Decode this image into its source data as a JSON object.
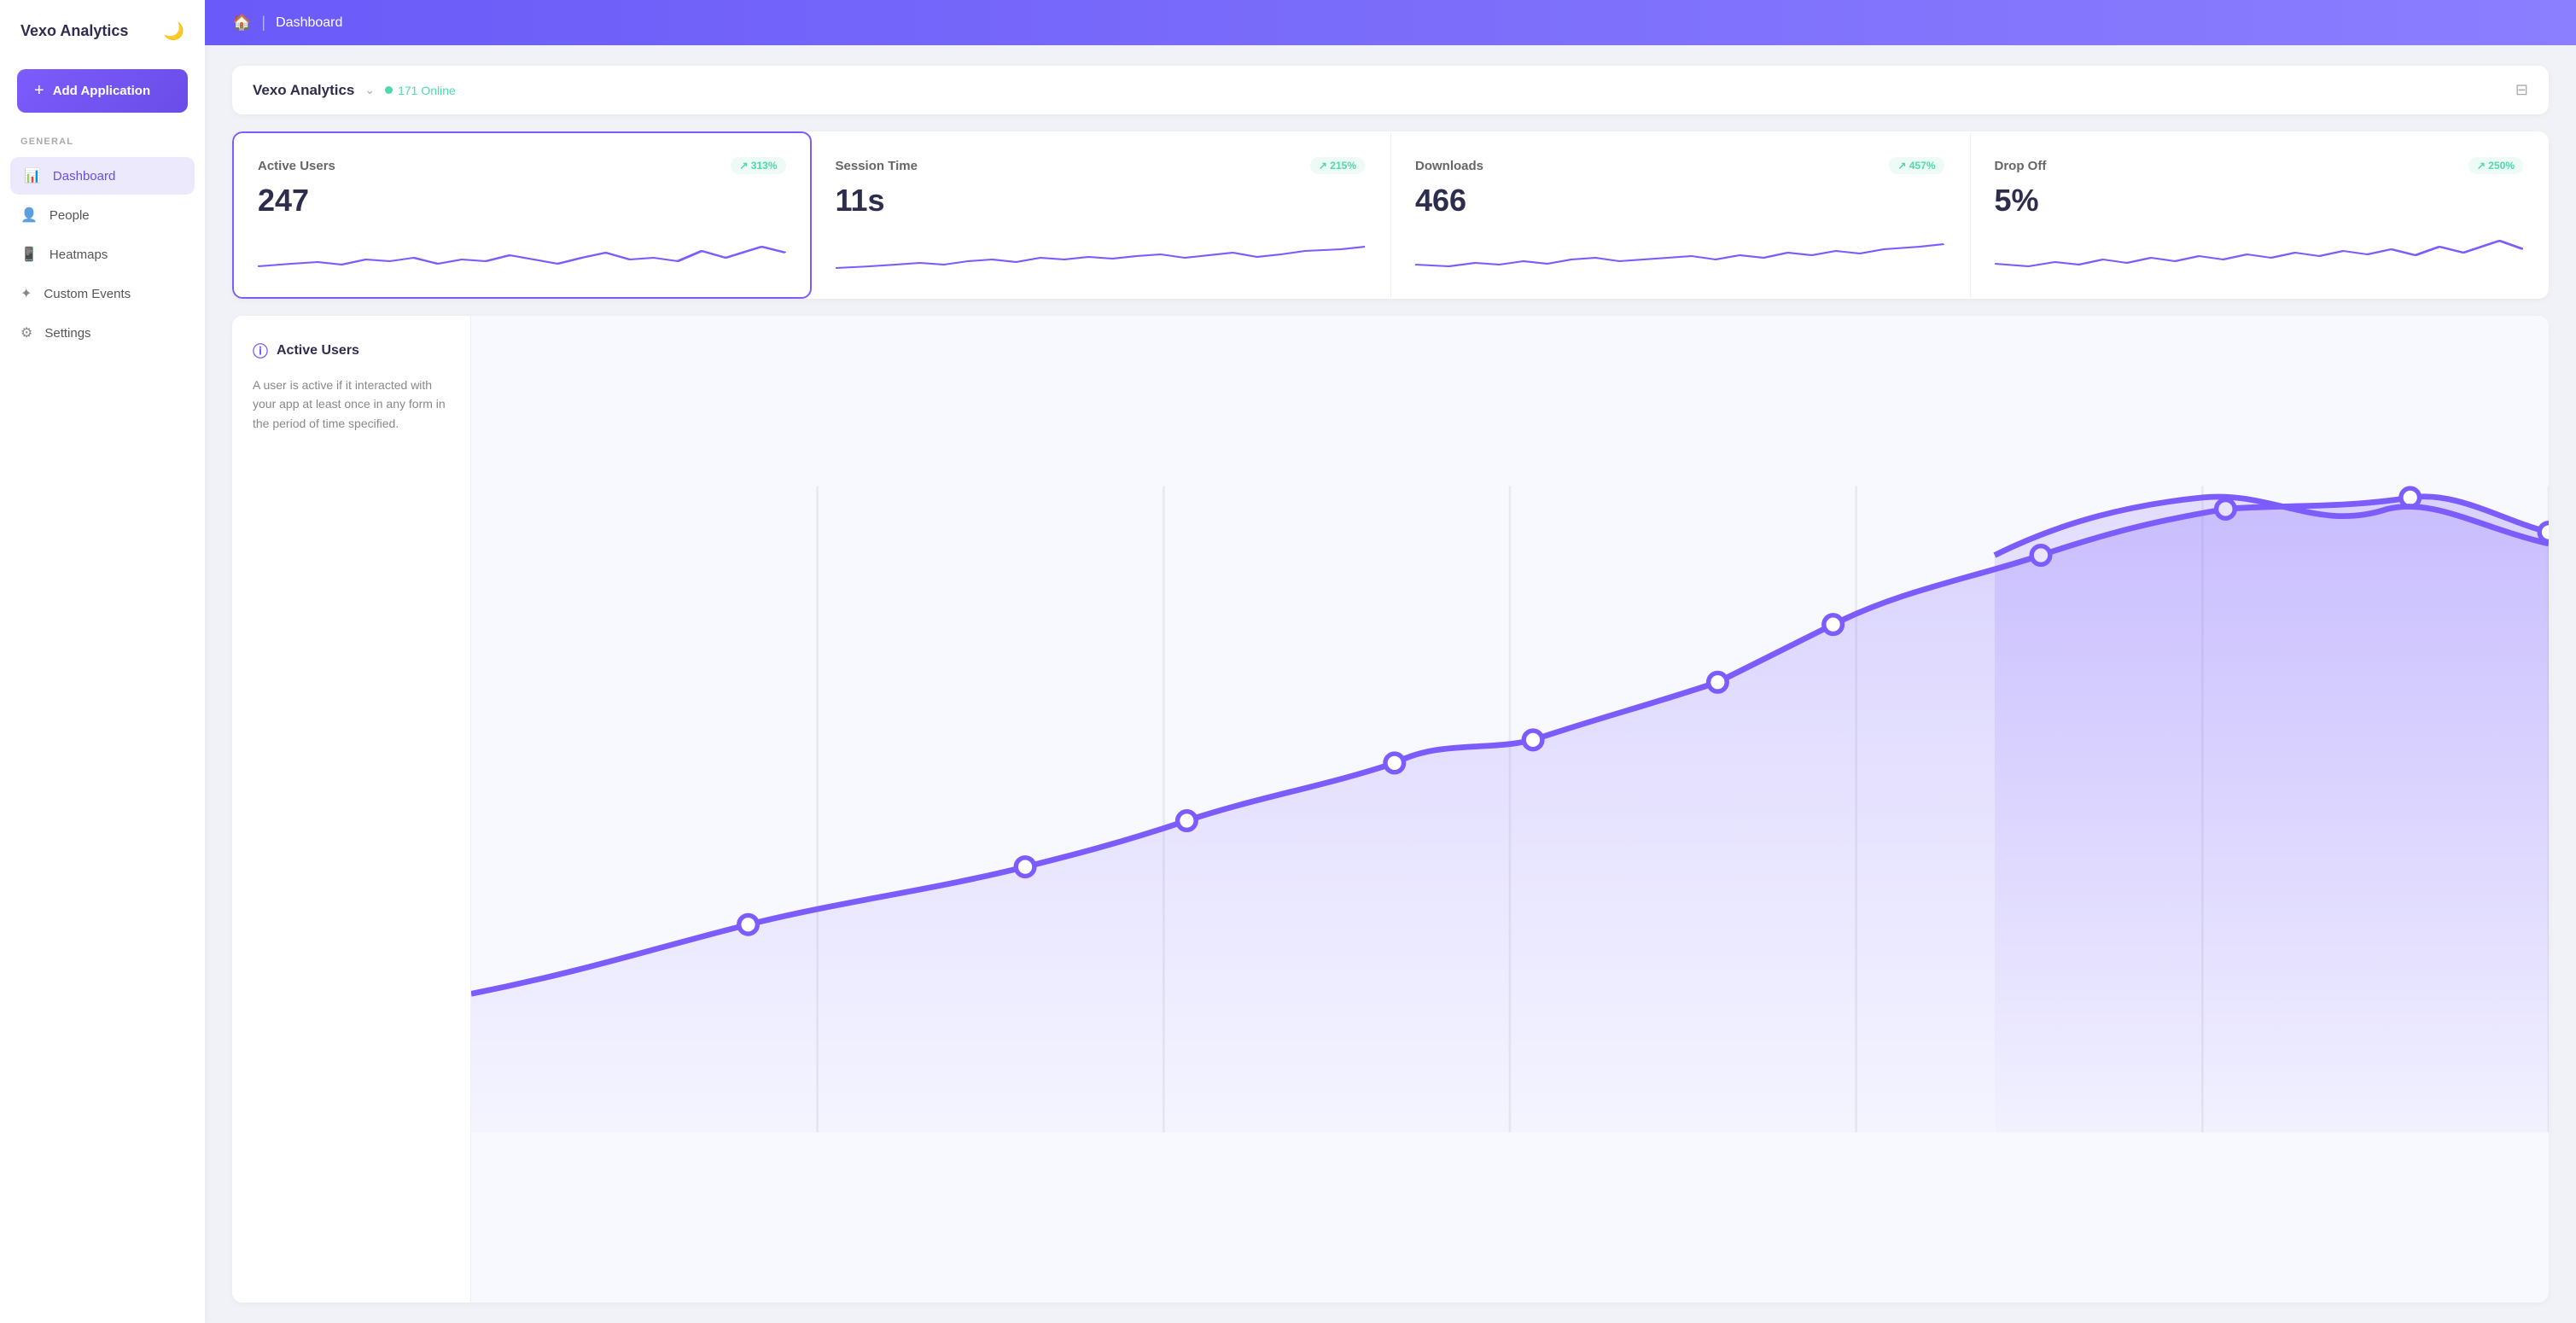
{
  "sidebar": {
    "logo": "Vexo Analytics",
    "logo_icon": "🌙",
    "add_btn_label": "Add Application",
    "section_label": "GENERAL",
    "nav_items": [
      {
        "id": "dashboard",
        "label": "Dashboard",
        "icon": "📊",
        "active": true
      },
      {
        "id": "people",
        "label": "People",
        "icon": "👤",
        "active": false
      },
      {
        "id": "heatmaps",
        "label": "Heatmaps",
        "icon": "📱",
        "active": false
      },
      {
        "id": "custom-events",
        "label": "Custom Events",
        "icon": "✦",
        "active": false
      },
      {
        "id": "settings",
        "label": "Settings",
        "icon": "⚙",
        "active": false
      }
    ]
  },
  "topbar": {
    "home_icon": "🏠",
    "title": "Dashboard"
  },
  "app_selector": {
    "app_name": "Vexo Analytics",
    "online_count": "171 Online",
    "filter_icon": "⊟"
  },
  "stats": [
    {
      "label": "Active Users",
      "badge": "↗ 313%",
      "value": "247"
    },
    {
      "label": "Session Time",
      "badge": "↗ 215%",
      "value": "11s"
    },
    {
      "label": "Downloads",
      "badge": "↗ 457%",
      "value": "466"
    },
    {
      "label": "Drop Off",
      "badge": "↗ 250%",
      "value": "5%"
    }
  ],
  "info_panel": {
    "title": "Active Users",
    "description": "A user is active if it interacted with your app at least once in any form in the period of time specified."
  },
  "colors": {
    "accent": "#7c5cfc",
    "green": "#4dd9ac",
    "badge_bg": "#edfaf5"
  }
}
